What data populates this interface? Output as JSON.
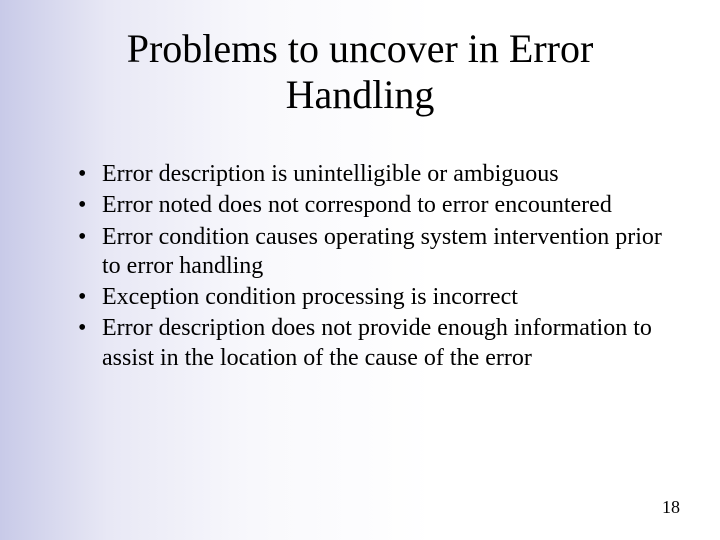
{
  "title": "Problems to uncover in Error Handling",
  "bullets": [
    "Error description is unintelligible or ambiguous",
    "Error noted does not correspond to error encountered",
    "Error condition causes operating system intervention prior to error handling",
    "Exception condition processing is incorrect",
    "Error description does not provide enough information to assist in the location of the cause of the error"
  ],
  "page_number": "18"
}
